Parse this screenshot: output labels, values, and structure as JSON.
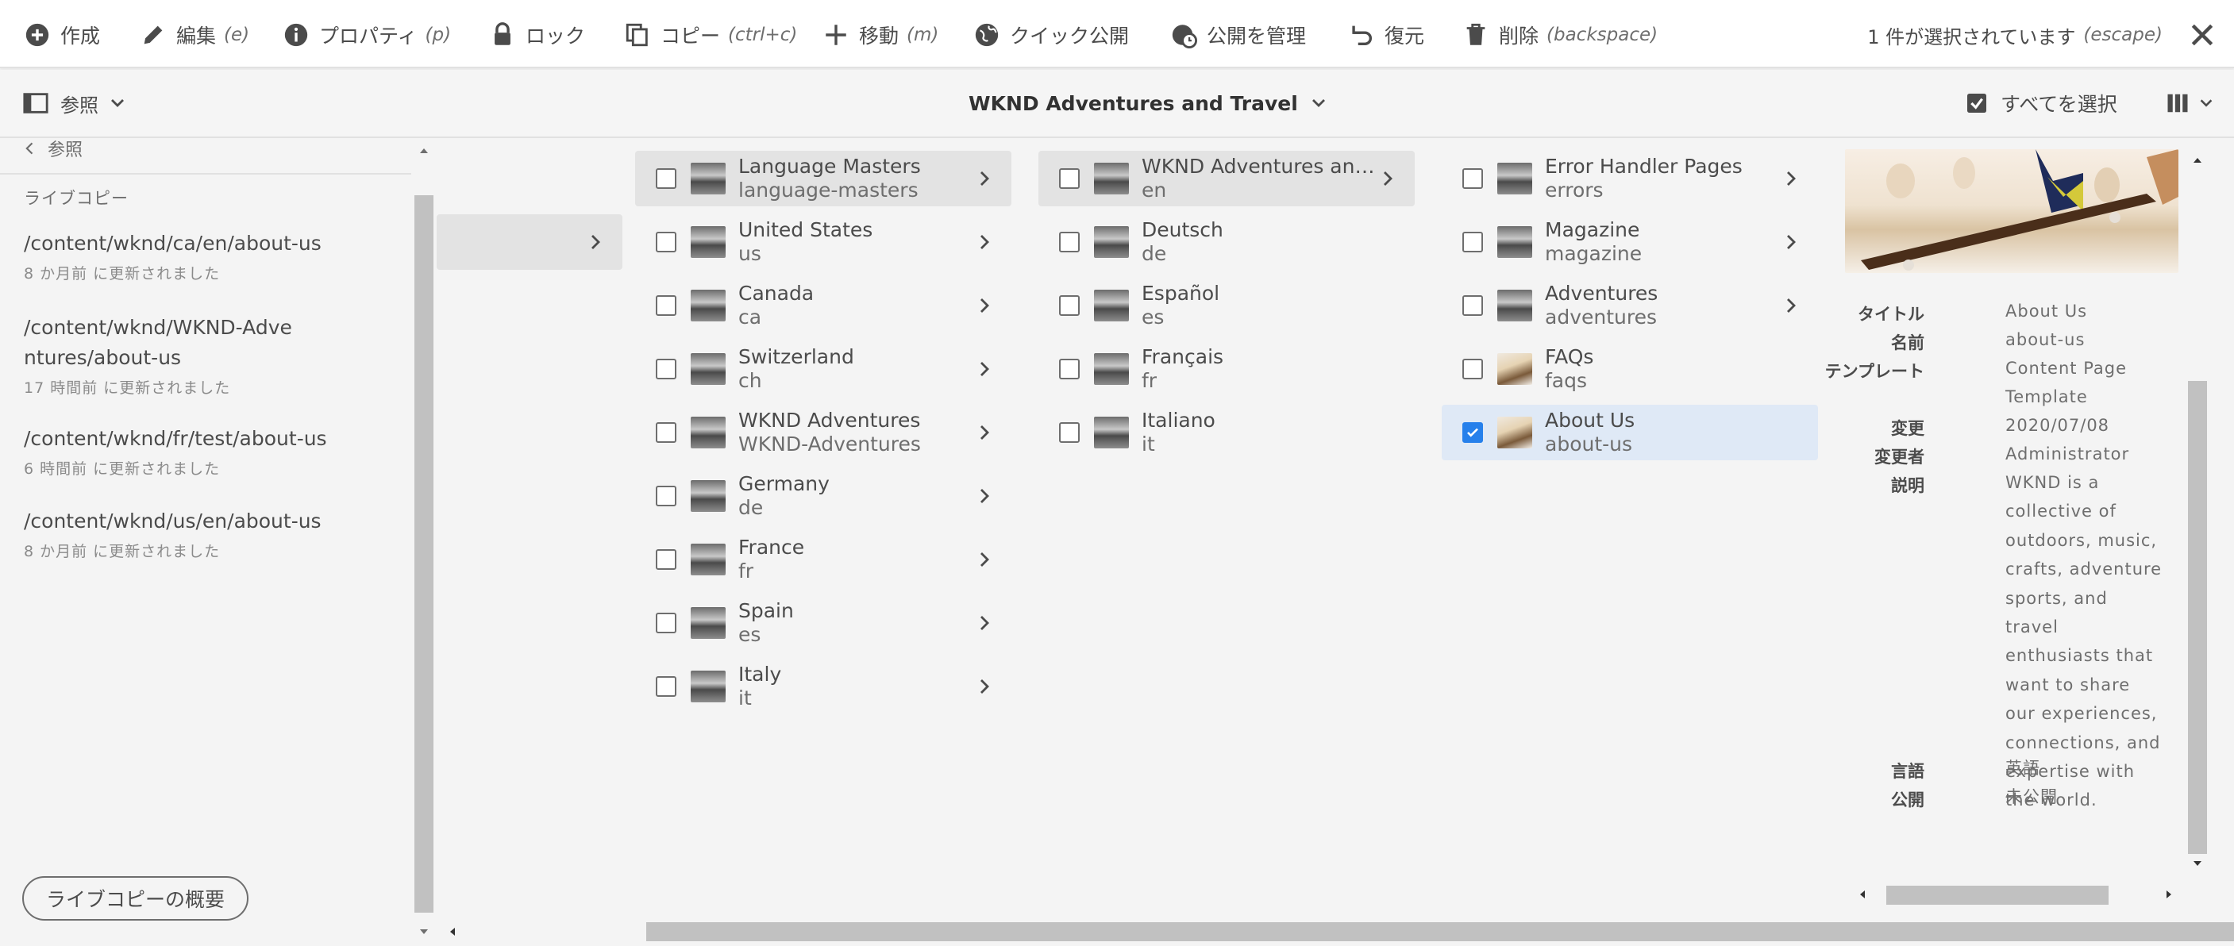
{
  "actionbar": {
    "items": [
      {
        "label": "作成",
        "shortcut": "",
        "icon": "plus-circle-icon"
      },
      {
        "label": "編集",
        "shortcut": "(e)",
        "icon": "edit-pencil-icon"
      },
      {
        "label": "プロパティ",
        "shortcut": "(p)",
        "icon": "info-icon"
      },
      {
        "label": "ロック",
        "shortcut": "",
        "icon": "lock-icon"
      },
      {
        "label": "コピー",
        "shortcut": "(ctrl+c)",
        "icon": "copy-icon"
      },
      {
        "label": "移動",
        "shortcut": "(m)",
        "icon": "move-icon"
      },
      {
        "label": "クイック公開",
        "shortcut": "",
        "icon": "globe-icon"
      },
      {
        "label": "公開を管理",
        "shortcut": "",
        "icon": "globe-clock-icon"
      },
      {
        "label": "復元",
        "shortcut": "",
        "icon": "undo-icon"
      },
      {
        "label": "削除",
        "shortcut": "(backspace)",
        "icon": "trash-icon"
      }
    ],
    "selection_text": "1 件が選択されています",
    "selection_shortcut": "(escape)"
  },
  "header": {
    "rail_label": "参照",
    "title": "WKND Adventures and Travel",
    "select_all": "すべてを選択"
  },
  "rail": {
    "back_label": "参照",
    "heading": "ライブコピー",
    "items": [
      {
        "path": "/content/wknd/ca/en/about-us",
        "time": "8 か月前 に更新されました"
      },
      {
        "path": "/content/wknd/WKND-Adventures/about-us",
        "time": "17 時間前 に更新されました"
      },
      {
        "path": "/content/wknd/fr/test/about-us",
        "time": "6 時間前 に更新されました"
      },
      {
        "path": "/content/wknd/us/en/about-us",
        "time": "8 か月前 に更新されました"
      }
    ],
    "overview_button": "ライブコピーの概要"
  },
  "columns": [
    [
      {
        "title": "Language Masters",
        "name": "language-masters",
        "active": true
      },
      {
        "title": "United States",
        "name": "us"
      },
      {
        "title": "Canada",
        "name": "ca"
      },
      {
        "title": "Switzerland",
        "name": "ch"
      },
      {
        "title": "WKND Adventures",
        "name": "WKND-Adventures"
      },
      {
        "title": "Germany",
        "name": "de"
      },
      {
        "title": "France",
        "name": "fr"
      },
      {
        "title": "Spain",
        "name": "es"
      },
      {
        "title": "Italy",
        "name": "it"
      }
    ],
    [
      {
        "title": "WKND Adventures and Travel",
        "name": "en",
        "active": true
      },
      {
        "title": "Deutsch",
        "name": "de",
        "noarrow": true
      },
      {
        "title": "Español",
        "name": "es",
        "noarrow": true
      },
      {
        "title": "Français",
        "name": "fr",
        "noarrow": true
      },
      {
        "title": "Italiano",
        "name": "it",
        "noarrow": true
      }
    ],
    [
      {
        "title": "Error Handler Pages",
        "name": "errors"
      },
      {
        "title": "Magazine",
        "name": "magazine"
      },
      {
        "title": "Adventures",
        "name": "adventures"
      },
      {
        "title": "FAQs",
        "name": "faqs",
        "noarrow": true,
        "thumb": "skater"
      },
      {
        "title": "About Us",
        "name": "about-us",
        "noarrow": true,
        "selected": true,
        "thumb": "skater"
      }
    ]
  ],
  "preview": {
    "meta": [
      {
        "key": "タイトル",
        "value": "About Us"
      },
      {
        "key": "名前",
        "value": "about-us"
      },
      {
        "key": "テンプレート",
        "value": "Content Page Template"
      },
      {
        "key": "変更",
        "value": "2020/07/08"
      },
      {
        "key": "変更者",
        "value": "Administrator"
      },
      {
        "key": "説明",
        "value": "WKND is a collective of outdoors, music, crafts, adventure sports, and travel enthusiasts that want to share our experiences, connections, and expertise with the world."
      },
      {
        "key": "言語",
        "value": "英語"
      },
      {
        "key": "公開",
        "value": "未公開"
      }
    ]
  },
  "colors": {
    "accent": "#2680eb",
    "selected_row": "#dfe9f6",
    "active_row": "#e3e3e3"
  }
}
